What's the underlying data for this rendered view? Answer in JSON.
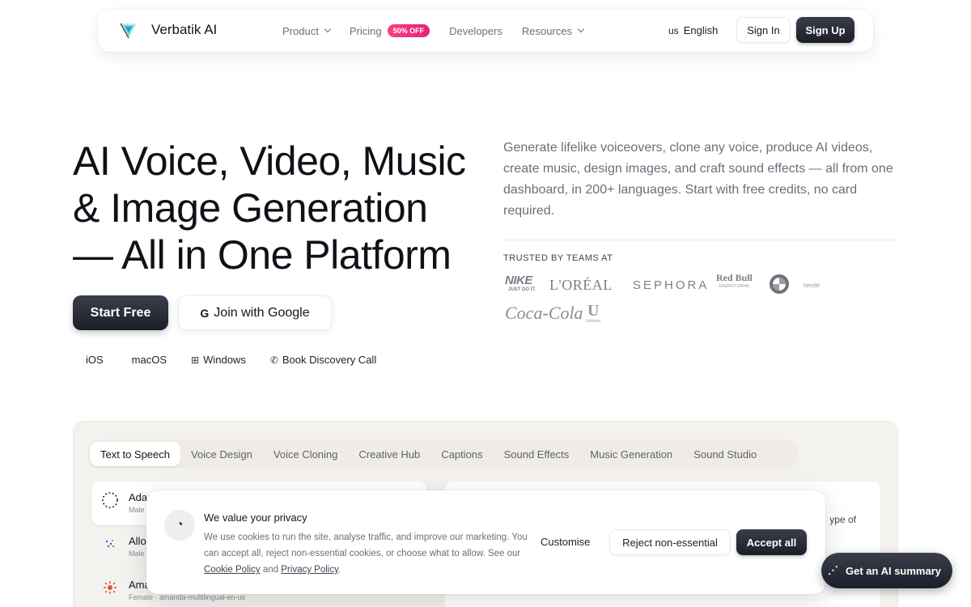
{
  "brand": {
    "name": "Verbatik AI"
  },
  "nav": {
    "items": [
      {
        "label": "Product",
        "dropdown": true
      },
      {
        "label": "Pricing",
        "badge": "50% OFF"
      },
      {
        "label": "Developers"
      },
      {
        "label": "Resources",
        "dropdown": true
      }
    ],
    "lang_code": "us",
    "lang_label": "English",
    "signin": "Sign In",
    "signup": "Sign Up"
  },
  "hero": {
    "title_line1": "AI Voice, Video, Music",
    "title_line2": "& Image Generation",
    "title_line3": "— All in One Platform",
    "description": "Generate lifelike voiceovers, clone any voice, produce AI videos, create music, design images, and craft sound effects — all from one dashboard, in 200+ languages. Start with free credits, no card required.",
    "cta_primary": "Start Free",
    "cta_google": "Join with Google",
    "platforms": [
      "iOS",
      "macOS",
      "Windows",
      "Book Discovery Call"
    ],
    "trusted_label": "TRUSTED BY TEAMS AT",
    "logos": [
      "NIKE",
      "JUST DO IT.",
      "L'ORÉAL",
      "SEPHORA",
      "Red Bull",
      "ENERGY DRINK",
      "BMW",
      "Nestlé",
      "Coca-Cola",
      "Unilever"
    ]
  },
  "panel": {
    "tabs": [
      "Text to Speech",
      "Voice Design",
      "Voice Cloning",
      "Creative Hub",
      "Captions",
      "Sound Effects",
      "Music Generation",
      "Sound Studio"
    ],
    "voices": [
      {
        "name": "Adam",
        "meta": "Male"
      },
      {
        "name": "Allo",
        "meta": "Male"
      },
      {
        "name": "Amanda",
        "meta": "Female · amanda-multilingual-en-us"
      }
    ],
    "editor_text": "ype of"
  },
  "cookie": {
    "title": "We value your privacy",
    "body_text": "We use cookies to run the site, analyse traffic, and improve our marketing. You can accept all, reject non-essential cookies, or choose what to allow. See our",
    "link_cookie": "Cookie Policy",
    "and": "and",
    "link_privacy": "Privacy Policy",
    "customise": "Customise",
    "reject": "Reject non-essential",
    "accept": "Accept all"
  },
  "ai_summary": {
    "label": "Get an AI summary"
  }
}
